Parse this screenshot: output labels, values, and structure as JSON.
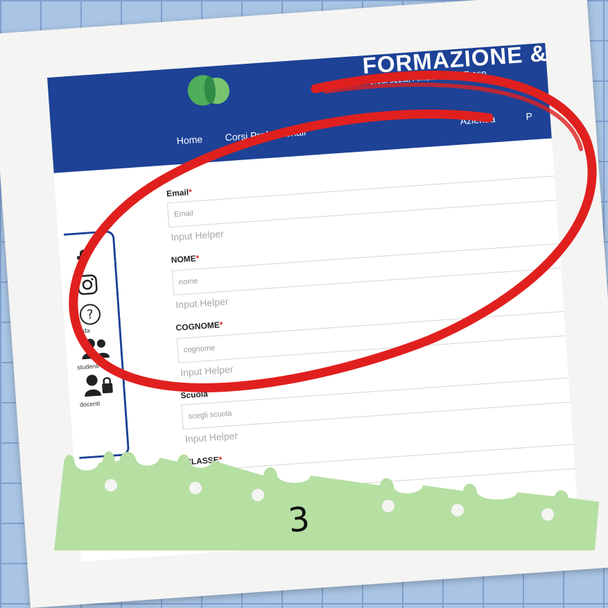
{
  "header": {
    "brand_title": "FORMAZIONE &",
    "brand_subtitle": "Sicurezza, Affidabilità e Trasp",
    "nav": {
      "home": "Home",
      "corsi": "Corsi Professionali",
      "azienda": "Azienda",
      "p": "P"
    }
  },
  "form": {
    "email": {
      "label": "Email",
      "placeholder": "Email",
      "helper": "Input Helper"
    },
    "nome": {
      "label": "NOME",
      "placeholder": "nome",
      "helper": "Input Helper"
    },
    "cognome": {
      "label": "COGNOME",
      "placeholder": "cognome",
      "helper": "Input Helper"
    },
    "scuola": {
      "label": "Scuola",
      "placeholder": "scegli scuola",
      "helper": "Input Helper"
    },
    "classe": {
      "label": "CLASSE"
    },
    "required_mark": "*"
  },
  "sidebar": {
    "icons": [
      "facebook-icon",
      "instagram-icon",
      "help-icon",
      "students-icon",
      "teacher-lock-icon"
    ],
    "guida": "guida",
    "studenti": "studenti",
    "docenti": "docenti"
  },
  "page_number": "3",
  "colors": {
    "header": "#1d4296",
    "grid_background": "#a9c4e4",
    "annotation_red": "#e0201e",
    "tape_green": "#b6dfa2",
    "required": "#dd2222"
  }
}
